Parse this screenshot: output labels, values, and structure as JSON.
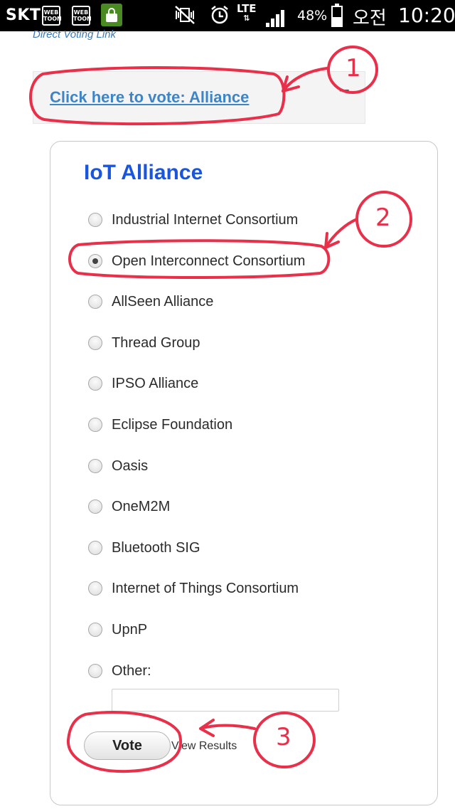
{
  "status_bar": {
    "carrier": "SKT",
    "app_icon_1": "WEB TOON",
    "app_icon_2": "WEB TOON",
    "network": "LTE",
    "battery": "48%",
    "ampm": "오전",
    "time": "10:20"
  },
  "page": {
    "direct_link": "Direct Voting Link",
    "vote_link": "Click here to vote: Alliance",
    "collapse": "–"
  },
  "poll": {
    "title": "IoT Alliance",
    "options": [
      {
        "label": "Industrial Internet Consortium",
        "checked": false
      },
      {
        "label": "Open Interconnect Consortium",
        "checked": true
      },
      {
        "label": "AllSeen Alliance",
        "checked": false
      },
      {
        "label": "Thread Group",
        "checked": false
      },
      {
        "label": "IPSO Alliance",
        "checked": false
      },
      {
        "label": "Eclipse Foundation",
        "checked": false
      },
      {
        "label": "Oasis",
        "checked": false
      },
      {
        "label": "OneM2M",
        "checked": false
      },
      {
        "label": "Bluetooth SIG",
        "checked": false
      },
      {
        "label": "Internet of Things Consortium",
        "checked": false
      },
      {
        "label": "UpnP",
        "checked": false
      },
      {
        "label": "Other:",
        "checked": false
      }
    ],
    "other_value": "",
    "vote_button": "Vote",
    "view_results": "View Results"
  },
  "annotations": {
    "step1": "1",
    "step2": "2",
    "step3": "3",
    "color": "#e8304a"
  }
}
